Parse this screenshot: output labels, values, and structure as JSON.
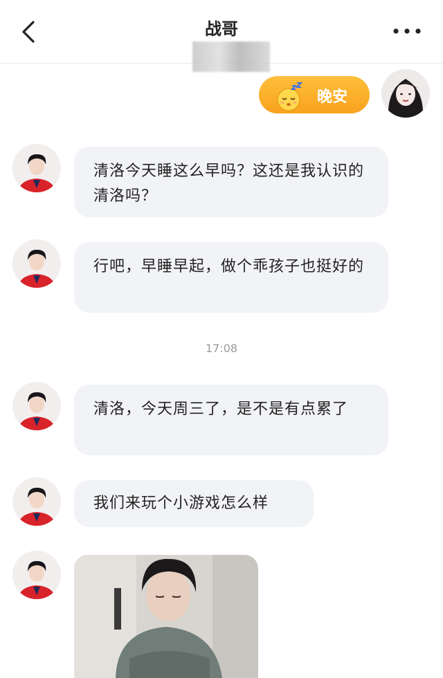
{
  "header": {
    "title": "战哥"
  },
  "sticker": {
    "text": "晚安",
    "icon": "sleeping-face-icon"
  },
  "messages": [
    {
      "text": "清洛今天睡这么早吗？这还是我认识的清洛吗？"
    },
    {
      "text": "行吧，早睡早起，做个乖孩子也挺好的"
    },
    {
      "text": "清洛，今天周三了，是不是有点累了"
    },
    {
      "text": "我们来玩个小游戏怎么样"
    }
  ],
  "timestamp": "17:08",
  "colors": {
    "sticker_bg": "#f9a21e",
    "bubble_bg": "#f2f3f7",
    "timestamp": "#9a9a9a"
  }
}
